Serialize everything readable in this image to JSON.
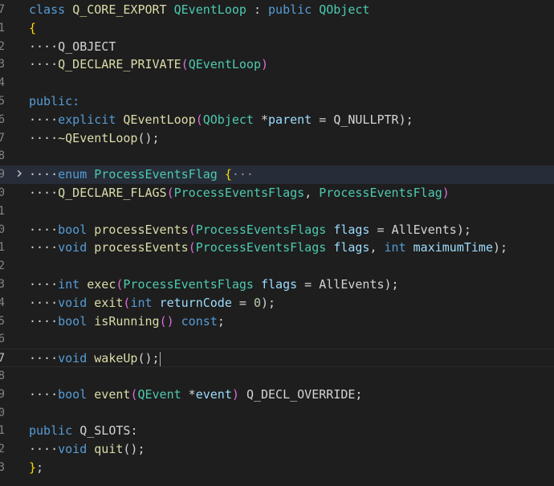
{
  "editor": {
    "lines": [
      {
        "n": "7",
        "tokens": [
          [
            "class",
            "keyword"
          ],
          [
            " ",
            "plain"
          ],
          [
            "Q_CORE_EXPORT",
            "macro"
          ],
          [
            " ",
            "plain"
          ],
          [
            "QEventLoop",
            "type"
          ],
          [
            " : ",
            "punct"
          ],
          [
            "public",
            "keyword"
          ],
          [
            " ",
            "plain"
          ],
          [
            "QObject",
            "type"
          ]
        ]
      },
      {
        "n": "1",
        "tokens": [
          [
            "{",
            "brace"
          ]
        ]
      },
      {
        "n": "2",
        "tokens": [
          [
            "····",
            "ws"
          ],
          [
            "Q_OBJECT",
            "plain"
          ]
        ]
      },
      {
        "n": "3",
        "tokens": [
          [
            "····",
            "ws"
          ],
          [
            "Q_DECLARE_PRIVATE",
            "macro"
          ],
          [
            "(",
            "paren"
          ],
          [
            "QEventLoop",
            "type"
          ],
          [
            ")",
            "paren"
          ]
        ]
      },
      {
        "n": "4",
        "tokens": []
      },
      {
        "n": "5",
        "tokens": [
          [
            "public:",
            "keyword"
          ]
        ]
      },
      {
        "n": "6",
        "tokens": [
          [
            "····",
            "ws"
          ],
          [
            "explicit",
            "keyword"
          ],
          [
            " ",
            "plain"
          ],
          [
            "QEventLoop",
            "func"
          ],
          [
            "(",
            "paren"
          ],
          [
            "QObject",
            "type"
          ],
          [
            " *",
            "punct"
          ],
          [
            "parent",
            "param"
          ],
          [
            " = ",
            "punct"
          ],
          [
            "Q_NULLPTR",
            "plain"
          ],
          [
            ");",
            "punct"
          ]
        ]
      },
      {
        "n": "7",
        "tokens": [
          [
            "····",
            "ws"
          ],
          [
            "~QEventLoop",
            "func"
          ],
          [
            "();",
            "punct"
          ]
        ]
      },
      {
        "n": "8",
        "tokens": []
      },
      {
        "n": "9",
        "tokens": [
          [
            "····",
            "ws"
          ],
          [
            "enum",
            "keyword"
          ],
          [
            " ",
            "plain"
          ],
          [
            "ProcessEventsFlag",
            "type"
          ],
          [
            " ",
            "plain"
          ],
          [
            "{",
            "brace"
          ],
          [
            "···",
            "ellipsis"
          ]
        ]
      },
      {
        "n": "0",
        "tokens": [
          [
            "····",
            "ws"
          ],
          [
            "Q_DECLARE_FLAGS",
            "macro"
          ],
          [
            "(",
            "paren"
          ],
          [
            "ProcessEventsFlags",
            "type"
          ],
          [
            ", ",
            "punct"
          ],
          [
            "ProcessEventsFlag",
            "type"
          ],
          [
            ")",
            "paren"
          ]
        ]
      },
      {
        "n": "1",
        "tokens": []
      },
      {
        "n": "0",
        "tokens": [
          [
            "····",
            "ws"
          ],
          [
            "bool",
            "keyword"
          ],
          [
            " ",
            "plain"
          ],
          [
            "processEvents",
            "func"
          ],
          [
            "(",
            "paren"
          ],
          [
            "ProcessEventsFlags",
            "type"
          ],
          [
            " ",
            "plain"
          ],
          [
            "flags",
            "param"
          ],
          [
            " = ",
            "punct"
          ],
          [
            "AllEvents",
            "plain"
          ],
          [
            ");",
            "punct"
          ]
        ]
      },
      {
        "n": "1",
        "tokens": [
          [
            "····",
            "ws"
          ],
          [
            "void",
            "keyword"
          ],
          [
            " ",
            "plain"
          ],
          [
            "processEvents",
            "func"
          ],
          [
            "(",
            "paren"
          ],
          [
            "ProcessEventsFlags",
            "type"
          ],
          [
            " ",
            "plain"
          ],
          [
            "flags",
            "param"
          ],
          [
            ", ",
            "punct"
          ],
          [
            "int",
            "keyword"
          ],
          [
            " ",
            "plain"
          ],
          [
            "maximumTime",
            "param"
          ],
          [
            ");",
            "punct"
          ]
        ]
      },
      {
        "n": "2",
        "tokens": []
      },
      {
        "n": "3",
        "tokens": [
          [
            "····",
            "ws"
          ],
          [
            "int",
            "keyword"
          ],
          [
            " ",
            "plain"
          ],
          [
            "exec",
            "func"
          ],
          [
            "(",
            "paren"
          ],
          [
            "ProcessEventsFlags",
            "type"
          ],
          [
            " ",
            "plain"
          ],
          [
            "flags",
            "param"
          ],
          [
            " = ",
            "punct"
          ],
          [
            "AllEvents",
            "plain"
          ],
          [
            ");",
            "punct"
          ]
        ]
      },
      {
        "n": "4",
        "tokens": [
          [
            "····",
            "ws"
          ],
          [
            "void",
            "keyword"
          ],
          [
            " ",
            "plain"
          ],
          [
            "exit",
            "func"
          ],
          [
            "(",
            "paren"
          ],
          [
            "int",
            "keyword"
          ],
          [
            " ",
            "plain"
          ],
          [
            "returnCode",
            "param"
          ],
          [
            " = ",
            "punct"
          ],
          [
            "0",
            "number"
          ],
          [
            ");",
            "punct"
          ]
        ]
      },
      {
        "n": "5",
        "tokens": [
          [
            "····",
            "ws"
          ],
          [
            "bool",
            "keyword"
          ],
          [
            " ",
            "plain"
          ],
          [
            "isRunning",
            "func"
          ],
          [
            "()",
            "paren"
          ],
          [
            " ",
            "plain"
          ],
          [
            "const",
            "keyword"
          ],
          [
            ";",
            "punct"
          ]
        ]
      },
      {
        "n": "6",
        "tokens": []
      },
      {
        "n": "7",
        "tokens": [
          [
            "····",
            "ws"
          ],
          [
            "void",
            "keyword"
          ],
          [
            " ",
            "plain"
          ],
          [
            "wakeUp",
            "func"
          ],
          [
            "();",
            "punct"
          ]
        ]
      },
      {
        "n": "8",
        "tokens": []
      },
      {
        "n": "9",
        "tokens": [
          [
            "····",
            "ws"
          ],
          [
            "bool",
            "keyword"
          ],
          [
            " ",
            "plain"
          ],
          [
            "event",
            "func"
          ],
          [
            "(",
            "paren"
          ],
          [
            "QEvent",
            "type"
          ],
          [
            " *",
            "punct"
          ],
          [
            "event",
            "param"
          ],
          [
            ")",
            "paren"
          ],
          [
            " ",
            "plain"
          ],
          [
            "Q_DECL_OVERRIDE",
            "plain"
          ],
          [
            ";",
            "punct"
          ]
        ]
      },
      {
        "n": "0",
        "tokens": []
      },
      {
        "n": "1",
        "tokens": [
          [
            "public",
            "keyword"
          ],
          [
            " ",
            "plain"
          ],
          [
            "Q_SLOTS",
            "plain"
          ],
          [
            ":",
            "punct"
          ]
        ]
      },
      {
        "n": "2",
        "tokens": [
          [
            "····",
            "ws"
          ],
          [
            "void",
            "keyword"
          ],
          [
            " ",
            "plain"
          ],
          [
            "quit",
            "func"
          ],
          [
            "();",
            "punct"
          ]
        ]
      },
      {
        "n": "3",
        "tokens": [
          [
            "}",
            "brace"
          ],
          [
            ";",
            "punct"
          ]
        ]
      }
    ],
    "folded_line_index": 9,
    "fold_icon": "chevron-right-icon",
    "cursor_line_index": 19,
    "active_line_number": "7"
  }
}
